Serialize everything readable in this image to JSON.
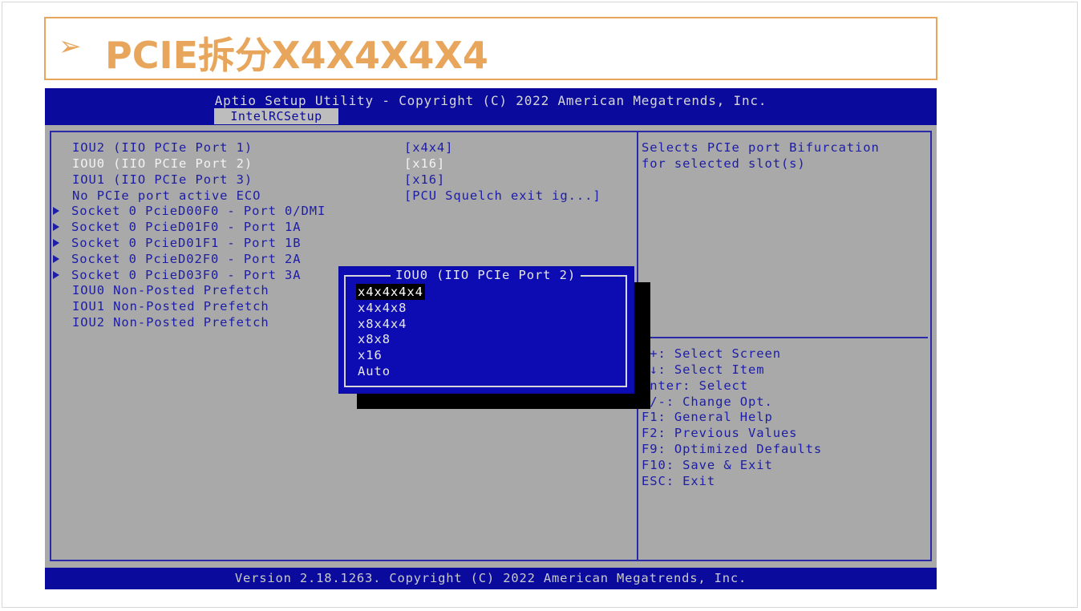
{
  "slide": {
    "title_arrow": "➢",
    "title": "PCIE拆分X4X4X4X4"
  },
  "bios": {
    "header": "Aptio Setup Utility - Copyright (C) 2022 American Megatrends, Inc.",
    "tab": "IntelRCSetup",
    "items": [
      {
        "label": "IOU2 (IIO PCIe Port 1)",
        "value": "[x4x4]",
        "submenu": false,
        "highlighted": false
      },
      {
        "label": "IOU0 (IIO PCIe Port 2)",
        "value": "[x16]",
        "submenu": false,
        "highlighted": true
      },
      {
        "label": "IOU1 (IIO PCIe Port 3)",
        "value": "[x16]",
        "submenu": false,
        "highlighted": false
      },
      {
        "label": "No PCIe port active ECO",
        "value": "[PCU Squelch exit ig...]",
        "submenu": false,
        "highlighted": false
      },
      {
        "label": "Socket 0 PcieD00F0 - Port 0/DMI",
        "value": "",
        "submenu": true,
        "highlighted": false
      },
      {
        "label": "Socket 0 PcieD01F0 - Port 1A",
        "value": "",
        "submenu": true,
        "highlighted": false
      },
      {
        "label": "Socket 0 PcieD01F1 - Port 1B",
        "value": "",
        "submenu": true,
        "highlighted": false
      },
      {
        "label": "Socket 0 PcieD02F0 - Port 2A",
        "value": "",
        "submenu": true,
        "highlighted": false
      },
      {
        "label": "Socket 0 PcieD03F0 - Port 3A",
        "value": "",
        "submenu": true,
        "highlighted": false
      },
      {
        "label": "IOU0 Non-Posted Prefetch",
        "value": "",
        "submenu": false,
        "highlighted": false
      },
      {
        "label": "IOU1 Non-Posted Prefetch",
        "value": "",
        "submenu": false,
        "highlighted": false
      },
      {
        "label": "IOU2 Non-Posted Prefetch",
        "value": "",
        "submenu": false,
        "highlighted": false
      }
    ],
    "help_text": [
      "Selects PCIe port Bifurcation",
      "for selected slot(s)"
    ],
    "key_help": [
      "++: Select Screen",
      "↑↓: Select Item",
      "Enter: Select",
      "+/-: Change Opt.",
      "F1: General Help",
      "F2: Previous Values",
      "F9: Optimized Defaults",
      "F10: Save & Exit",
      "ESC: Exit"
    ],
    "footer": "Version 2.18.1263. Copyright (C) 2022 American Megatrends, Inc.",
    "popup": {
      "title": "IOU0 (IIO PCIe Port 2)",
      "options": [
        "x4x4x4x4",
        "x4x4x8",
        "x8x4x4",
        "x8x8",
        "x16",
        "Auto"
      ],
      "selected_index": 0
    },
    "colors": {
      "blue_bar": "#0a0b9c",
      "panel_gray": "#a9a9a9",
      "text_blue": "#1d1da6",
      "title_orange": "#e8a65c"
    }
  }
}
